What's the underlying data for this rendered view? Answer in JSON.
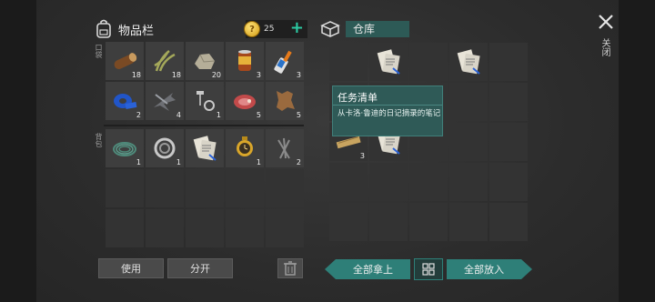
{
  "inventory": {
    "title": "物品栏",
    "coins": "25",
    "plus_label": "+",
    "pocket_label": "口袋",
    "backpack_label": "背包",
    "pocket_items": [
      {
        "name": "log",
        "count": "18"
      },
      {
        "name": "plant-fiber",
        "count": "18"
      },
      {
        "name": "stone",
        "count": "20"
      },
      {
        "name": "canned-food",
        "count": "3"
      },
      {
        "name": "glue",
        "count": "3"
      },
      {
        "name": "duct-tape",
        "count": "2"
      },
      {
        "name": "scrap-metal",
        "count": "4"
      },
      {
        "name": "nails-bolts",
        "count": "1"
      },
      {
        "name": "raw-meat",
        "count": "5"
      },
      {
        "name": "leather",
        "count": "5"
      }
    ],
    "backpack_items": [
      {
        "name": "wire-coil",
        "count": "1"
      },
      {
        "name": "bearing",
        "count": "1"
      },
      {
        "name": "notes",
        "count": ""
      },
      {
        "name": "watch",
        "count": "1"
      },
      {
        "name": "nails",
        "count": "2"
      }
    ]
  },
  "storage": {
    "title": "仓库",
    "items": [
      {
        "name": "notes",
        "count": ""
      },
      {
        "name": "notes",
        "count": ""
      },
      {
        "name": "plank",
        "count": "3"
      },
      {
        "name": "notes",
        "count": ""
      }
    ]
  },
  "tooltip": {
    "title": "任务清单",
    "description": "从卡洛·鲁迪的日记摘录的笔记"
  },
  "buttons": {
    "use": "使用",
    "split": "分开",
    "take_all": "全部拿上",
    "put_all": "全部放入",
    "close": "关闭"
  },
  "colors": {
    "accent": "#2e7f78",
    "tooltip_bg": "#2f5a57",
    "slot_bg": "#3e3e3e"
  }
}
